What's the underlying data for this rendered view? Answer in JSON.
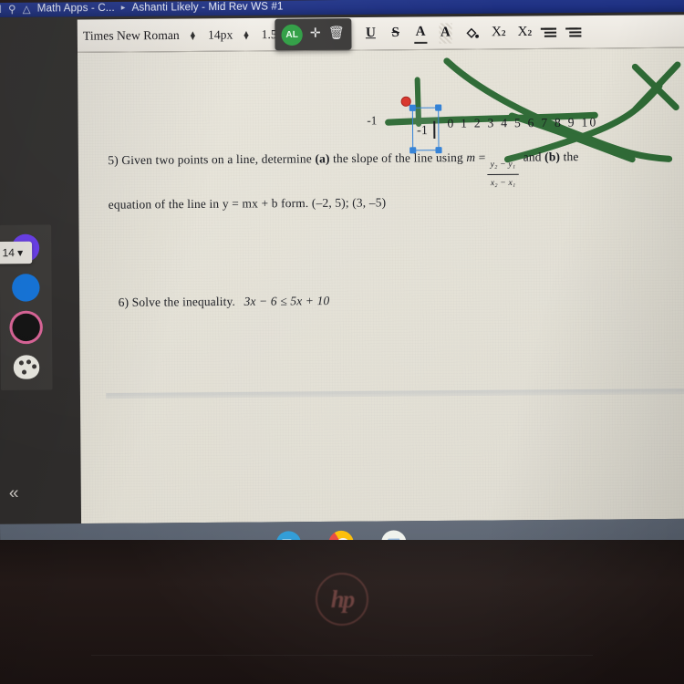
{
  "browser_bar": {
    "icons": [
      "window-icon",
      "search-icon",
      "drive-icon"
    ],
    "tab_title": "Math Apps - C...",
    "separator": "▸",
    "document_title": "Ashanti Likely - Mid Rev WS #1"
  },
  "toolbar": {
    "font_family": "Times New Roman",
    "font_size": "14px",
    "line_spacing": "1.5pt",
    "icons": [
      {
        "name": "underline-icon",
        "glyph": "U"
      },
      {
        "name": "strikethrough-icon",
        "glyph": "S"
      },
      {
        "name": "text-color-icon",
        "glyph": "A"
      },
      {
        "name": "highlight-color-icon",
        "glyph": "A"
      },
      {
        "name": "fill-color-icon",
        "glyph": "◇"
      },
      {
        "name": "subscript-icon",
        "glyph": "X",
        "script": "2"
      },
      {
        "name": "superscript-icon",
        "glyph": "X",
        "script": "2"
      },
      {
        "name": "bulleted-list-icon",
        "glyph": "≡"
      },
      {
        "name": "numbered-list-icon",
        "glyph": "≡"
      }
    ]
  },
  "collaborator_tag": {
    "initials": "AL",
    "avatar_color": "#2f9e44",
    "move_icon": "✛",
    "delete_icon": "🗑"
  },
  "sidebar": {
    "size_value": "14",
    "size_caret": "▾",
    "swatches": [
      {
        "name": "swatch-purple",
        "color": "#6a3df0",
        "selected": false
      },
      {
        "name": "swatch-blue",
        "color": "#1276e0",
        "selected": false
      },
      {
        "name": "swatch-black",
        "color": "#121212",
        "selected": true
      }
    ],
    "palette_icon": "palette-icon",
    "collapse_icon": "«"
  },
  "document": {
    "number_line": {
      "left_label": "-1",
      "ticks": "0 1 2 3 4 5 6 7 8 9 10"
    },
    "selected_textbox": {
      "value": "-1",
      "handle_color": "#2f7fd6",
      "rotate_handle_color": "#d8342b"
    },
    "annotation_color": "#2f6b36",
    "questions": [
      {
        "number": "5)",
        "line1_a": "Given two points on a line, determine ",
        "label_a": "(a)",
        "line1_b": " the slope of the line using ",
        "var_m": "m",
        "equals": "=",
        "frac_num": "y₂ − y₁",
        "frac_den": "x₂ − x₁",
        "line1_c": " and ",
        "label_b": "(b)",
        "line1_d": " the",
        "line2": "equation of the line in y = mx + b form.   (–2, 5); (3, –5)"
      },
      {
        "number": "6)",
        "prompt": "Solve the inequality.",
        "expression": "3x − 6 ≤ 5x + 10"
      }
    ]
  },
  "taskbar": {
    "apps": [
      {
        "name": "meet-icon",
        "label": "Meet"
      },
      {
        "name": "chrome-icon",
        "label": "Chrome"
      },
      {
        "name": "docs-icon",
        "label": "Docs"
      }
    ]
  },
  "device": {
    "brand": "hp"
  }
}
